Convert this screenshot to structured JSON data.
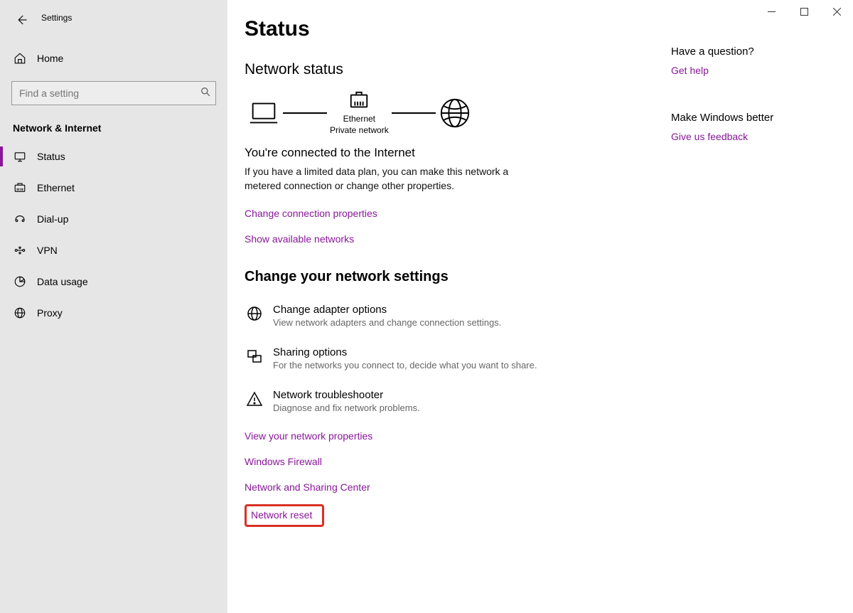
{
  "window": {
    "app_title": "Settings"
  },
  "sidebar": {
    "home_label": "Home",
    "search_placeholder": "Find a setting",
    "section_title": "Network & Internet",
    "items": [
      {
        "label": "Status"
      },
      {
        "label": "Ethernet"
      },
      {
        "label": "Dial-up"
      },
      {
        "label": "VPN"
      },
      {
        "label": "Data usage"
      },
      {
        "label": "Proxy"
      }
    ]
  },
  "main": {
    "page_title": "Status",
    "network_status_title": "Network status",
    "diagram": {
      "eth_line1": "Ethernet",
      "eth_line2": "Private network"
    },
    "status_headline": "You're connected to the Internet",
    "status_desc": "If you have a limited data plan, you can make this network a metered connection or change other properties.",
    "link_change_conn": "Change connection properties",
    "link_show_networks": "Show available networks",
    "change_settings_title": "Change your network settings",
    "settings_items": [
      {
        "title": "Change adapter options",
        "desc": "View network adapters and change connection settings."
      },
      {
        "title": "Sharing options",
        "desc": "For the networks you connect to, decide what you want to share."
      },
      {
        "title": "Network troubleshooter",
        "desc": "Diagnose and fix network problems."
      }
    ],
    "link_view_props": "View your network properties",
    "link_firewall": "Windows Firewall",
    "link_sharing_center": "Network and Sharing Center",
    "link_reset": "Network reset"
  },
  "right": {
    "question_title": "Have a question?",
    "get_help": "Get help",
    "better_title": "Make Windows better",
    "feedback": "Give us feedback"
  }
}
